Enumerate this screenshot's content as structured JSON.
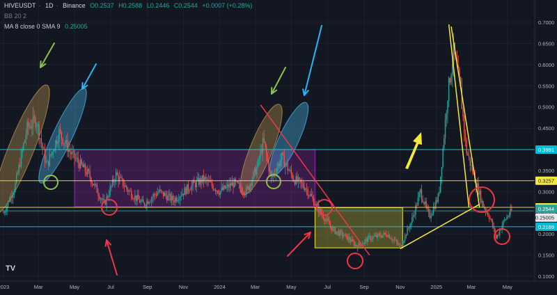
{
  "header": {
    "symbol": "HIVEUSDT",
    "interval": "1D",
    "exchange": "Binance",
    "open": "O0.2537",
    "high": "H0.2588",
    "low": "L0.2446",
    "close": "C0.2544",
    "change": "+0.0007 (+0.28%)",
    "bb_label": "BB 20 2",
    "ma_label": "MA 8 close 0 SMA 9",
    "ma_value": "0.25005"
  },
  "logo": "TV",
  "colors": {
    "background": "#131722",
    "grid": "#1e222d",
    "axis_text": "#b2b5be",
    "up_candle": "#26a69a",
    "down_candle": "#ef5350",
    "cyan_line": "#26c6da",
    "yellow_line": "#f5e83d",
    "red_line": "#f23645",
    "purple_box": "#9c27b0",
    "green_arrow": "#8bc34a",
    "blue_arrow": "#29b6f6"
  },
  "chart_data": {
    "type": "candlestick",
    "y_axis_scale": "linear",
    "ylim": [
      0.1,
      0.7
    ],
    "y_ticks": [
      "0.7000",
      "0.6500",
      "0.6000",
      "0.5500",
      "0.5000",
      "0.4500",
      "0.4000",
      "0.3500",
      "0.3000",
      "0.2500",
      "0.2000",
      "0.1500",
      "0.1000"
    ],
    "x_ticks": [
      "2023",
      "Mar",
      "May",
      "Jul",
      "Sep",
      "Nov",
      "2024",
      "Mar",
      "May",
      "Jul",
      "Sep",
      "Nov",
      "2025",
      "Mar",
      "May"
    ],
    "x_tick_dates": [
      "2023-01-01",
      "2023-03-01",
      "2023-05-01",
      "2023-07-01",
      "2023-09-01",
      "2023-11-01",
      "2024-01-01",
      "2024-03-01",
      "2024-05-01",
      "2024-07-01",
      "2024-09-01",
      "2024-11-01",
      "2025-01-01",
      "2025-03-01",
      "2025-05-01"
    ],
    "x_range": [
      "2023-01-01",
      "2025-05-20"
    ],
    "path_points": [
      [
        "2023-01-01",
        0.25
      ],
      [
        "2023-01-20",
        0.31
      ],
      [
        "2023-02-10",
        0.45
      ],
      [
        "2023-02-25",
        0.47
      ],
      [
        "2023-03-15",
        0.36
      ],
      [
        "2023-04-05",
        0.44
      ],
      [
        "2023-04-25",
        0.39
      ],
      [
        "2023-05-25",
        0.34
      ],
      [
        "2023-06-20",
        0.27
      ],
      [
        "2023-07-10",
        0.34
      ],
      [
        "2023-08-01",
        0.3
      ],
      [
        "2023-08-25",
        0.27
      ],
      [
        "2023-09-20",
        0.3
      ],
      [
        "2023-10-15",
        0.28
      ],
      [
        "2023-11-10",
        0.31
      ],
      [
        "2023-12-05",
        0.33
      ],
      [
        "2024-01-01",
        0.3
      ],
      [
        "2024-01-25",
        0.32
      ],
      [
        "2024-02-15",
        0.3
      ],
      [
        "2024-03-05",
        0.36
      ],
      [
        "2024-03-15",
        0.42
      ],
      [
        "2024-03-28",
        0.33
      ],
      [
        "2024-04-15",
        0.38
      ],
      [
        "2024-05-05",
        0.33
      ],
      [
        "2024-05-25",
        0.31
      ],
      [
        "2024-06-15",
        0.26
      ],
      [
        "2024-07-10",
        0.21
      ],
      [
        "2024-08-05",
        0.19
      ],
      [
        "2024-08-20",
        0.17
      ],
      [
        "2024-09-10",
        0.19
      ],
      [
        "2024-10-10",
        0.2
      ],
      [
        "2024-11-01",
        0.17
      ],
      [
        "2024-11-20",
        0.23
      ],
      [
        "2024-12-05",
        0.3
      ],
      [
        "2024-12-20",
        0.24
      ],
      [
        "2025-01-05",
        0.29
      ],
      [
        "2025-01-20",
        0.53
      ],
      [
        "2025-01-30",
        0.63
      ],
      [
        "2025-02-10",
        0.55
      ],
      [
        "2025-02-20",
        0.4
      ],
      [
        "2025-03-05",
        0.34
      ],
      [
        "2025-03-20",
        0.27
      ],
      [
        "2025-04-01",
        0.24
      ],
      [
        "2025-04-12",
        0.19
      ],
      [
        "2025-04-25",
        0.23
      ],
      [
        "2025-05-08",
        0.2544
      ]
    ],
    "horizontal_levels": [
      {
        "value": 0.3991,
        "label": "0.3991",
        "color": "#26c6da",
        "bg": "#00bcd4"
      },
      {
        "value": 0.3257,
        "label": "0.3257",
        "color": "#f5e83d",
        "bg": "#f5e83d"
      },
      {
        "value": 0.2627,
        "label": "0.2627",
        "color": "#f5e83d",
        "bg": "#f5e83d"
      },
      {
        "value": 0.2544,
        "label": "0.2544",
        "color": "#26a69a",
        "bg": "#26a69a"
      },
      {
        "value": 0.25005,
        "label": "0.25005",
        "color": "#ffffff",
        "bg": "#e8eaed"
      },
      {
        "value": 0.2169,
        "label": "0.2169",
        "color": "#26c6da",
        "bg": "#00bcd4"
      }
    ],
    "zones": [
      {
        "name": "purple-range-box",
        "x0": "2023-05-01",
        "x1": "2024-06-10",
        "y0": 0.264,
        "y1": 0.399,
        "color": "#9c27b0"
      },
      {
        "name": "yellow-range-box",
        "x0": "2024-06-10",
        "x1": "2024-11-05",
        "y0": 0.167,
        "y1": 0.262,
        "color": "#f5e83d"
      }
    ],
    "trendlines": [
      {
        "name": "red-downtrend-line",
        "from": [
          "2024-03-10",
          0.505
        ],
        "to": [
          "2024-09-10",
          0.15
        ],
        "color": "#f23645"
      },
      {
        "name": "yellow-uptrend-line",
        "from": [
          "2024-11-01",
          0.165
        ],
        "to": [
          "2025-03-15",
          0.27
        ],
        "color": "#f5e83d"
      },
      {
        "name": "yellow-crash-line-a",
        "from": [
          "2025-01-22",
          0.695
        ],
        "to": [
          "2025-02-25",
          0.262
        ],
        "color": "#f5e83d"
      },
      {
        "name": "yellow-crash-line-b",
        "from": [
          "2025-01-26",
          0.69
        ],
        "to": [
          "2025-03-15",
          0.262
        ],
        "color": "#f5e83d"
      }
    ]
  }
}
